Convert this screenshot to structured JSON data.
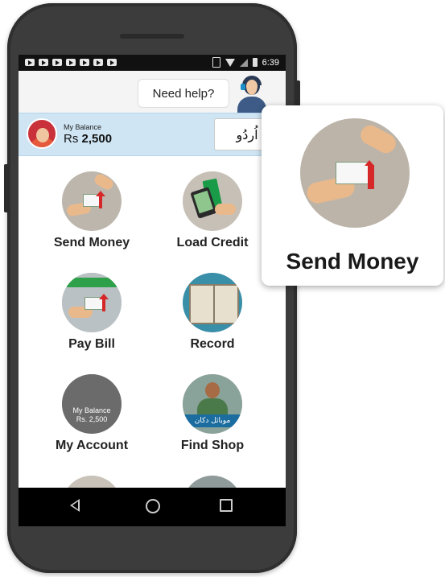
{
  "status_bar": {
    "time": "6:39",
    "notification_icons": [
      "video-icon",
      "video-icon",
      "video-icon",
      "video-icon",
      "video-icon",
      "video-icon",
      "p-icon"
    ],
    "system_icons": [
      "vibrate-icon",
      "wifi-icon",
      "signal-icon",
      "battery-icon"
    ]
  },
  "help": {
    "label": "Need help?",
    "icon": "support-agent-icon"
  },
  "balance": {
    "label": "My Balance",
    "currency": "Rs",
    "amount": "2,500",
    "language_button": "اُردُو"
  },
  "tiles": [
    {
      "label": "Send Money",
      "icon": "send-money-icon"
    },
    {
      "label": "Load Credit",
      "icon": "load-credit-icon"
    },
    {
      "label": "Pay Bill",
      "icon": "pay-bill-icon"
    },
    {
      "label": "Record",
      "icon": "record-book-icon"
    },
    {
      "label": "My Account",
      "icon": "my-account-icon",
      "overlay_label": "My Balance",
      "overlay_amount": "Rs. 2,500"
    },
    {
      "label": "Find Shop",
      "icon": "find-shop-icon",
      "overlay_sign": "موبائل دکان"
    }
  ],
  "nav": {
    "back": "back-icon",
    "home": "home-icon",
    "recent": "recent-apps-icon"
  },
  "zoom_callout": {
    "label": "Send Money",
    "icon": "send-money-icon"
  },
  "colors": {
    "balance_bar": "#cfe5f4",
    "phone_body": "#3c3c3c",
    "arrow_accent": "#d62828"
  }
}
